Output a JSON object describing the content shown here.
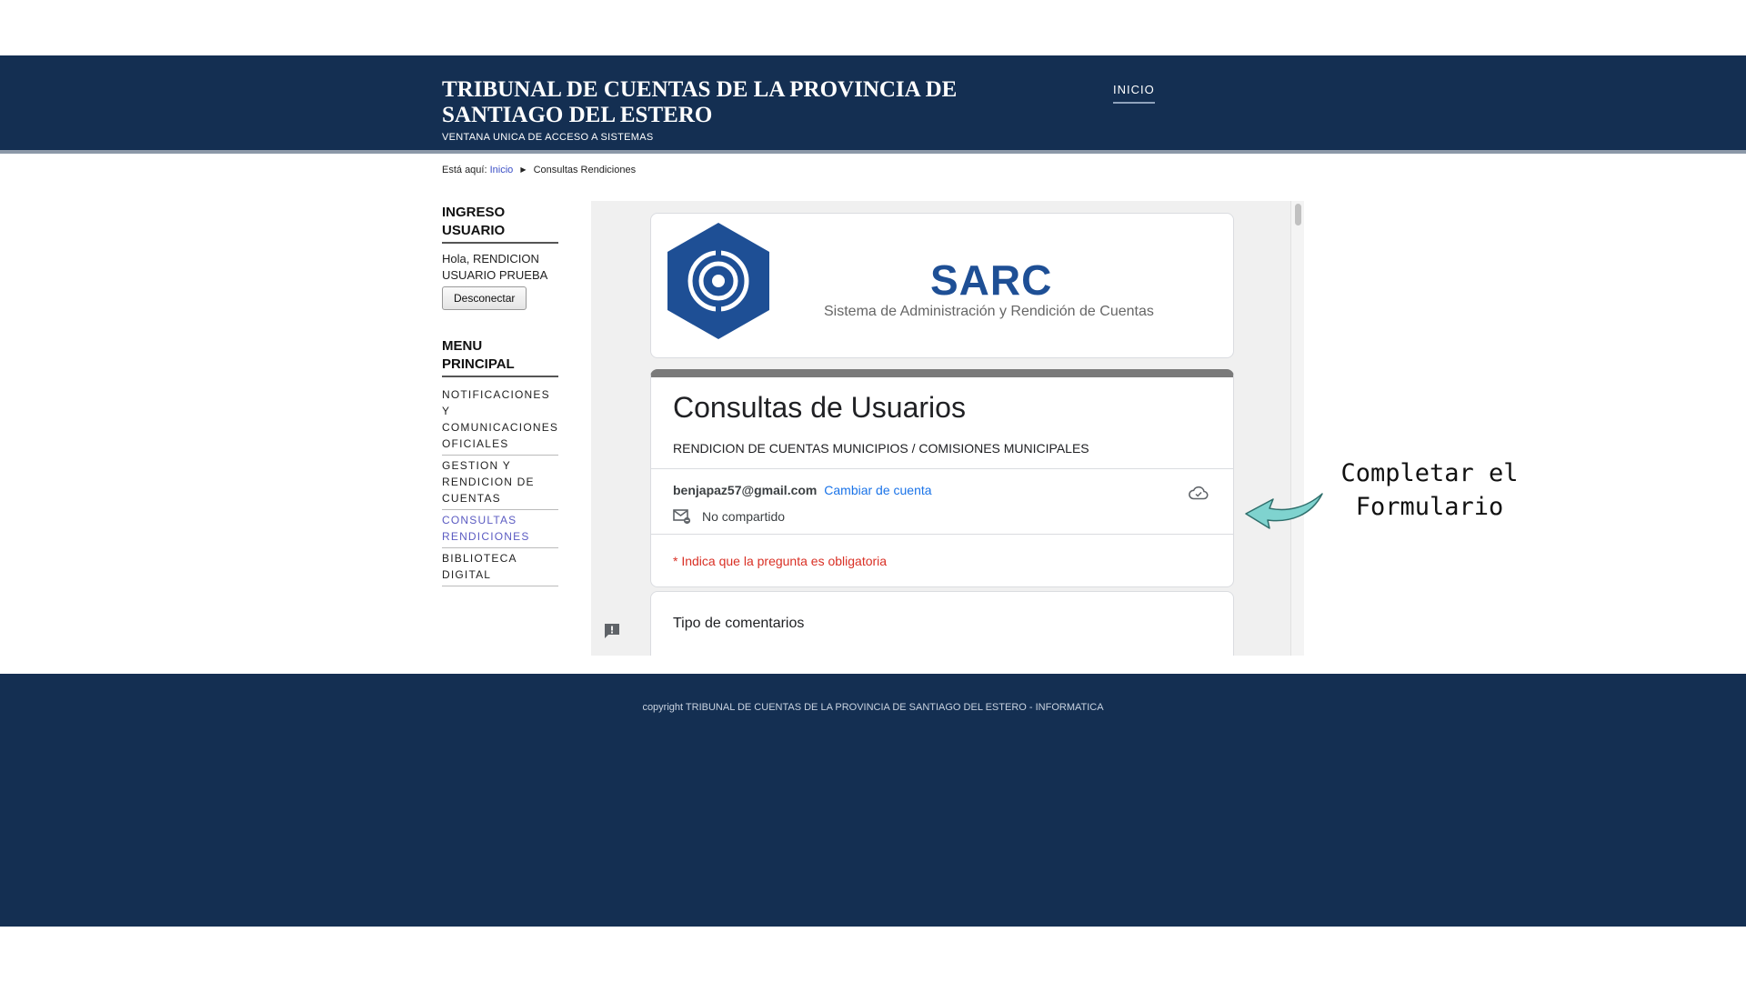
{
  "header": {
    "site_title": "TRIBUNAL DE CUENTAS DE LA PROVINCIA DE SANTIAGO DEL ESTERO",
    "site_subtitle": "VENTANA UNICA DE ACCESO A SISTEMAS",
    "nav": {
      "home_label": "INICIO"
    }
  },
  "breadcrumb": {
    "prefix": "Está aquí:",
    "home": "Inicio",
    "current": "Consultas Rendiciones"
  },
  "sidebar": {
    "login": {
      "heading": "INGRESO USUARIO",
      "greeting": "Hola, RENDICION USUARIO PRUEBA",
      "logout_label": "Desconectar"
    },
    "menu": {
      "heading": "MENU PRINCIPAL",
      "items": [
        {
          "label": "NOTIFICACIONES Y COMUNICACIONES OFICIALES",
          "active": false
        },
        {
          "label": "GESTION Y RENDICION DE CUENTAS",
          "active": false
        },
        {
          "label": "CONSULTAS RENDICIONES",
          "active": true
        },
        {
          "label": "BIBLIOTECA DIGITAL",
          "active": false
        }
      ]
    }
  },
  "form": {
    "logo_title": "SARC",
    "logo_subtitle": "Sistema de Administración y Rendición de Cuentas",
    "title": "Consultas de Usuarios",
    "description": "RENDICION DE CUENTAS MUNICIPIOS / COMISIONES MUNICIPALES",
    "account_email": "benjapaz57@gmail.com",
    "switch_account": "Cambiar de cuenta",
    "share_status": "No compartido",
    "required_note": "* Indica que la pregunta es obligatoria",
    "question_title": "Tipo de comentarios"
  },
  "annotation": {
    "line1": "Completar el",
    "line2": "Formulario"
  },
  "footer": {
    "copyright": "copyright TRIBUNAL DE CUENTAS DE LA PROVINCIA DE SANTIAGO DEL ESTERO - INFORMATICA"
  },
  "colors": {
    "header_bg": "#142f52",
    "footer_bg": "#142f52",
    "link": "#3b4fc6",
    "active_menu": "#5b5bc2",
    "google_link": "#1a73e8",
    "required": "#d93025",
    "sarc_blue": "#1e4f95",
    "annotation_arrow": "#7fd3cf"
  },
  "icons": {
    "logo": "sarc-hexagon-target-icon",
    "cloud": "cloud-save-icon",
    "share": "envelope-not-shared-icon",
    "report": "report-feedback-icon",
    "arrow": "curved-arrow-left-icon",
    "breadcrumb_sep": "triangle-right-icon"
  }
}
